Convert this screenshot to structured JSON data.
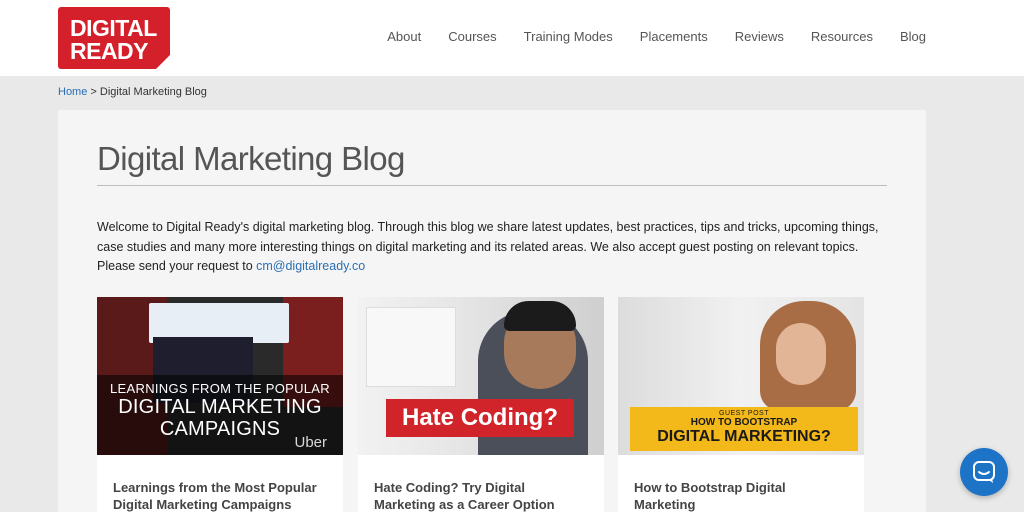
{
  "header": {
    "logo": {
      "line1": "DIGITAL",
      "line2": "READY",
      "color": "#d4202a"
    },
    "nav": [
      {
        "label": "About"
      },
      {
        "label": "Courses"
      },
      {
        "label": "Training Modes"
      },
      {
        "label": "Placements"
      },
      {
        "label": "Reviews"
      },
      {
        "label": "Resources"
      },
      {
        "label": "Blog"
      }
    ]
  },
  "breadcrumb": {
    "home": "Home",
    "separator": ">",
    "current": "Digital Marketing Blog"
  },
  "main": {
    "title": "Digital Marketing Blog",
    "intro": "Welcome to Digital Ready's digital marketing blog. Through this blog we share latest updates, best practices, tips and tricks, upcoming things, case studies and many more interesting things on digital marketing and its related areas. We also accept guest posting on relevant topics. Please send your request to ",
    "email": "cm@digitalready.co"
  },
  "cards": [
    {
      "image": {
        "line1": "LEARNINGS FROM THE POPULAR",
        "line2": "DIGITAL MARKETING",
        "line3": "CAMPAIGNS",
        "brand": "Uber"
      },
      "title": "Learnings from the Most Popular Digital Marketing Campaigns"
    },
    {
      "image": {
        "banner": "Hate Coding?"
      },
      "title": "Hate Coding? Try Digital Marketing as a Career Option"
    },
    {
      "image": {
        "tag": "GUEST POST",
        "line1": "HOW TO BOOTSTRAP",
        "line2": "DIGITAL MARKETING?"
      },
      "title": "How to Bootstrap Digital Marketing"
    }
  ],
  "chat": {
    "icon": "chat-bubble-icon",
    "color": "#1d74c7"
  }
}
